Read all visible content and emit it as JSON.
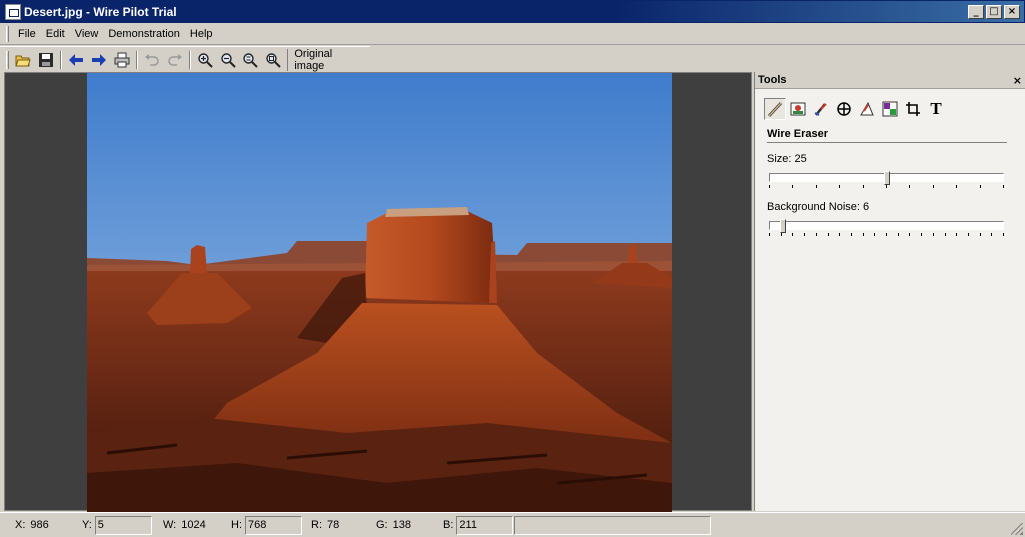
{
  "window": {
    "title": "Desert.jpg - Wire Pilot Trial",
    "controls": {
      "minimize": "_",
      "maximize": "□",
      "close": "×"
    }
  },
  "menu": {
    "items": [
      "File",
      "Edit",
      "View",
      "Demonstration",
      "Help"
    ]
  },
  "toolbar": {
    "buttons": [
      "open-icon",
      "save-icon",
      "back-icon",
      "forward-icon",
      "print-icon",
      "undo-icon",
      "redo-icon",
      "zoom-in-icon",
      "zoom-out-icon",
      "zoom-fit-icon",
      "zoom-actual-icon"
    ],
    "original_image_label": "Original image"
  },
  "tools_panel": {
    "header": "Tools",
    "close": "×",
    "icons": [
      "wire-eraser-icon",
      "image-restore-icon",
      "brush-icon",
      "clone-target-icon",
      "triangle-ruler-icon",
      "color-picker-icon",
      "crop-icon",
      "text-icon"
    ],
    "active_tool_index": 0,
    "text_icon_glyph": "T",
    "section_title": "Wire Eraser",
    "size": {
      "label": "Size: 25",
      "value": 25,
      "max": 50,
      "ticks": 11
    },
    "noise": {
      "label": "Background Noise: 6",
      "value": 6,
      "max": 100,
      "ticks": 21
    }
  },
  "statusbar": {
    "x": {
      "label": "X:",
      "value": "986"
    },
    "y": {
      "label": "Y:",
      "value": "5"
    },
    "w": {
      "label": "W:",
      "value": "1024"
    },
    "h": {
      "label": "H:",
      "value": "768"
    },
    "r": {
      "label": "R:",
      "value": "78"
    },
    "g": {
      "label": "G:",
      "value": "138"
    },
    "b": {
      "label": "B:",
      "value": "211"
    }
  },
  "colors": {
    "titlebar": "#0a246a",
    "canvas_bg": "#3f3f3f",
    "sky_top": "#4a86d0",
    "rock": "#a8431e"
  }
}
